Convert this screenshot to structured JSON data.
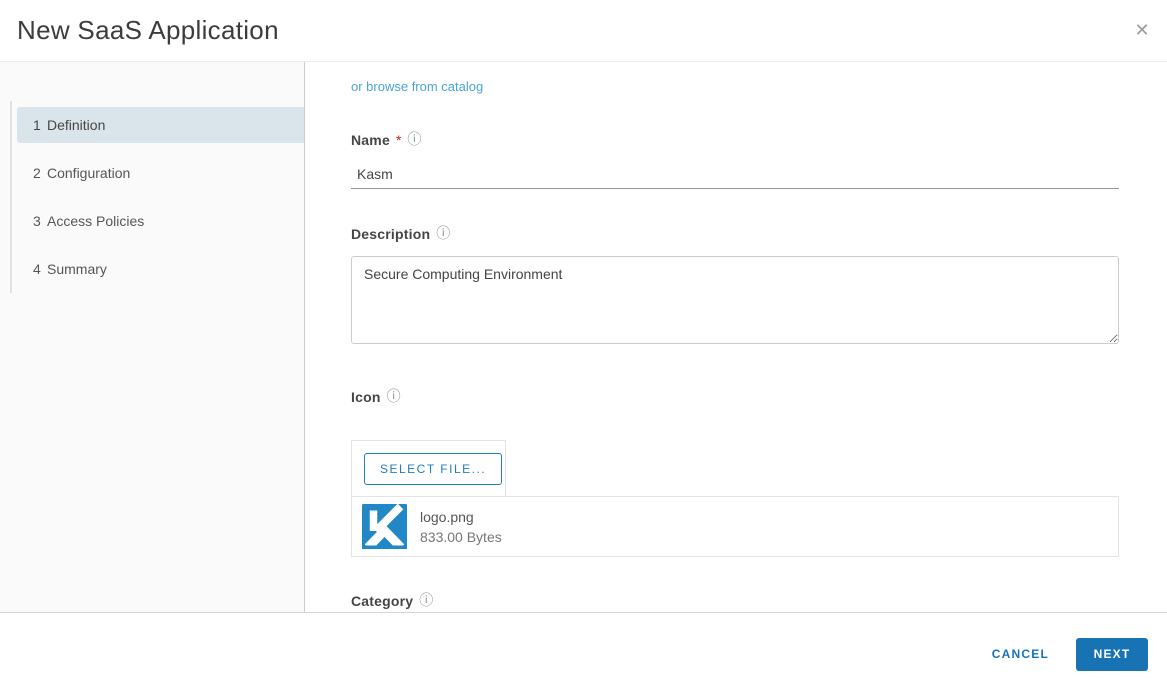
{
  "colors": {
    "primary_blue": "#1773b4",
    "select_file_blue": "#1f7ebe",
    "link_blue": "#4aa5da",
    "logo_blue": "#2187c5",
    "active_step_bg": "#d9e4eb",
    "required_red": "#c92100"
  },
  "header": {
    "title": "New SaaS Application"
  },
  "icons": {
    "info": "ⓘ",
    "close": "✕",
    "file_logo": "kasm-logo"
  },
  "wizard": {
    "steps": [
      {
        "number": "1",
        "label": "Definition"
      },
      {
        "number": "2",
        "label": "Configuration"
      },
      {
        "number": "3",
        "label": "Access Policies"
      },
      {
        "number": "4",
        "label": "Summary"
      }
    ]
  },
  "form": {
    "browse_link": "or browse from catalog",
    "name_field": {
      "label": "Name",
      "required_marker": "*",
      "value": "Kasm"
    },
    "description_field": {
      "label": "Description",
      "value": "Secure Computing Environment"
    },
    "icon_field": {
      "label": "Icon",
      "select_file_label": "SELECT FILE...",
      "file": {
        "name": "logo.png",
        "size": "833.00 Bytes"
      }
    },
    "category_field": {
      "label": "Category"
    }
  },
  "footer": {
    "cancel_label": "CANCEL",
    "next_label": "NEXT"
  }
}
